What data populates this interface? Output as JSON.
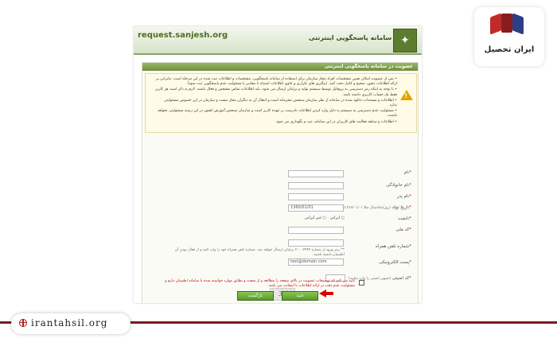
{
  "site": {
    "url": "request.sanjesh.org",
    "title": "سامانه پاسخگویی اینترنتی"
  },
  "panel": {
    "title": "عضویت در سامانه پاسخگویی اینترنتی",
    "notice": [
      "• پس از عضویت امکان تعیین مشخصات افراد مجاز سازمان برای استفاده از سامانه پاسخگویی، مشخصات و اطلاعات ثبت شده در این مرحله است. بنابراین بر ارائه اطلاعات دقیق، صحیح و کامل دقت کنید. (پیگیری های تکراری و حاوی اطلاعات اشتباه با مقادیر یا مسئولیت عدم پاسخگویی ثبت شود)",
      "• با توجه به اینکه رمز دسترسی به پروفایل توسط سیستم تولید و برایتان ارسال می شود، باید اطلاعات تماس مشخص و فعال باشند. لازم به ذکر است هر کاربر فقط یک حساب کاربری داشته باشد.",
      "• اطلاعات و مستندات دانلود شده در سامانه از نظر سازمان سنجش محرمانه است و انتقال آن به دیگران مجاز نیست و سازمان در این خصوص مسئولیتی ندارد.",
      "• مسئولیت عدم دسترسی به سیستم به دلیل وارد کردن اطلاعات نادرست بر عهده کاربر است و سازمان سنجش آموزش کشور در این زمینه مسئولیتی نخواهد داشت.",
      "• اطلاعات و سابقه فعالیت های کاربران در این سامانه، ثبت و نگهداری می شود."
    ]
  },
  "form": {
    "first_name_label": "نام",
    "last_name_label": "نام خانوادگی",
    "father_name_label": "نام پدر",
    "birth_date_label": "تاریخ تولد",
    "birth_date_hint": "(روز/ماه/سال مثلا ۱۳۶۸/۰۱/۰۱)",
    "birth_date_value": "1360/01/01",
    "nationality_label": "تابعیت",
    "nationality_options": [
      "ایرانی",
      "غیر ایرانی"
    ],
    "national_code_label": "کد ملی",
    "mobile_label": "شماره تلفن همراه",
    "mobile_hint": "** رمز ورود از شماره ۲۰۰۰۲۴۴۴ برایتان ارسال خواهد شد. شماره تلفن همراه خود را وارد کنید و از فعال بودن آن اطمینان داشته باشید.",
    "email_label": "پست الکترونیکی",
    "email_placeholder": "test@domain.com",
    "captcha_label": "کد امنیتی",
    "captcha_hint": "(تصویر امنیتی را وارد نمایید)",
    "captcha_text": "39",
    "confirm_text": "تایید می کنم که توضیحات عضویت در بالای صفحه را مطالعه و از صحت و تطابق موارد خواسته شده با سامانه اطمینان دارم و مسئولیت عدم دقت در ارائه اطلاعات با اینجانب می باشد.",
    "submit_label": "تایید",
    "back_label": "بازگشت"
  },
  "brand": {
    "name": "ایران تحصیل",
    "domain": "irantahsil.org"
  },
  "colors": {
    "accent_green": "#6f8f3c",
    "brand_red": "#b01e1e",
    "arrow_red": "#d90000"
  }
}
